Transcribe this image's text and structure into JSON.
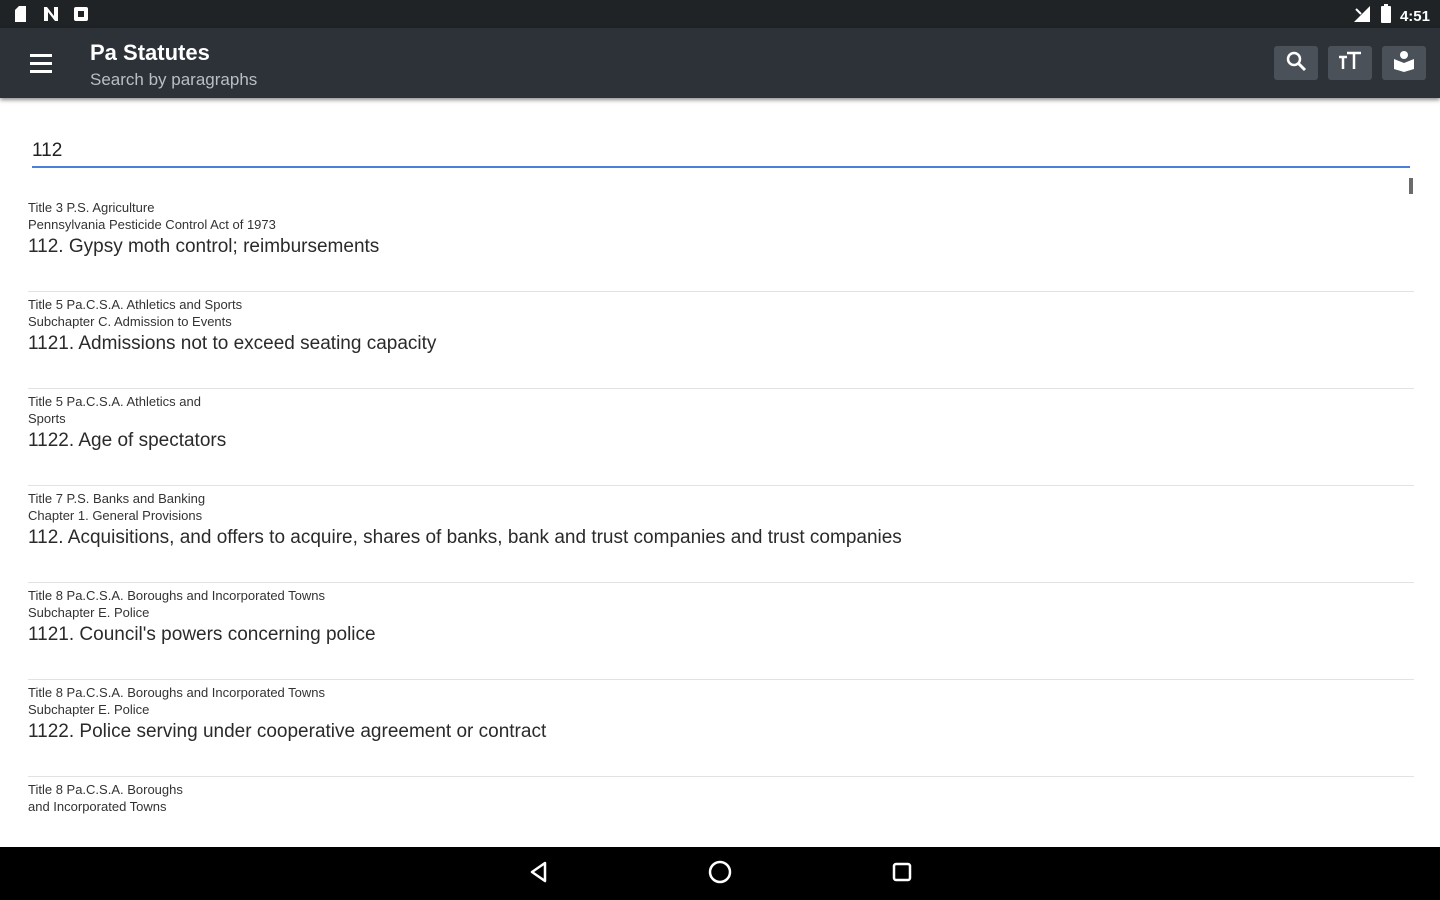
{
  "status_bar": {
    "time": "4:51",
    "left_icons": [
      "file-icon",
      "n-notification-icon",
      "photo-icon"
    ],
    "right_icons": [
      "signal-icon",
      "battery-icon"
    ]
  },
  "app_bar": {
    "title": "Pa Statutes",
    "subtitle": "Search by paragraphs",
    "actions": [
      "search-icon",
      "text-size-icon",
      "library-icon"
    ],
    "colors": {
      "bar": "#2c3238",
      "button": "#4a5158"
    }
  },
  "search": {
    "value": "112",
    "underline_color": "#4a80d9"
  },
  "results": [
    {
      "meta1": "Title 3 P.S. Agriculture",
      "meta2": "Pennsylvania Pesticide Control Act of 1973",
      "title": "112. Gypsy moth control;  reimbursements"
    },
    {
      "meta1": "Title 5 Pa.C.S.A. Athletics and Sports",
      "meta2": "Subchapter C. Admission to Events",
      "title": "1121. Admissions not to exceed seating capacity"
    },
    {
      "meta1": "Title 5 Pa.C.S.A. Athletics and",
      "meta2": "Sports",
      "title": "1122. Age of spectators"
    },
    {
      "meta1": "Title 7 P.S. Banks and Banking",
      "meta2": "Chapter 1. General Provisions",
      "title": "112. Acquisitions, and offers to acquire, shares of banks, bank and trust companies and trust companies"
    },
    {
      "meta1": "Title 8 Pa.C.S.A. Boroughs and Incorporated Towns",
      "meta2": "Subchapter E. Police",
      "title": "1121. Council's powers concerning police"
    },
    {
      "meta1": "Title 8 Pa.C.S.A. Boroughs and Incorporated Towns",
      "meta2": "Subchapter E. Police",
      "title": "1122. Police serving under cooperative agreement or contract"
    },
    {
      "meta1": "Title 8 Pa.C.S.A. Boroughs",
      "meta2": "and Incorporated Towns",
      "title": ""
    }
  ],
  "nav_bar": {
    "buttons": [
      "back-icon",
      "home-icon",
      "recents-icon"
    ]
  }
}
